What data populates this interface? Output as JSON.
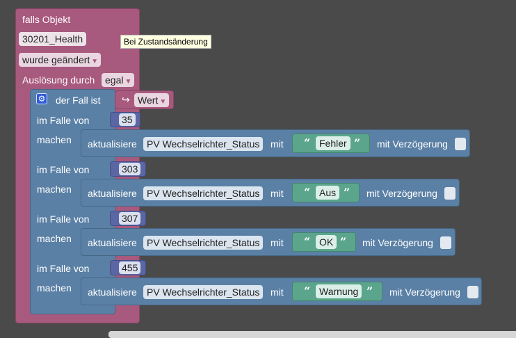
{
  "trigger": {
    "title": "falls Objekt",
    "object_id": "30201_Health",
    "condition": "wurde geändert",
    "trigger_label": "Auslösung durch",
    "trigger_value": "egal"
  },
  "tooltip": "Bei Zustandsänderung",
  "switch": {
    "label": "der Fall ist",
    "value_arrow": "↪",
    "value_label": "Wert",
    "case_label": "im Falle von",
    "do_label": "machen"
  },
  "cases": [
    {
      "value": "35",
      "action": "aktualisiere",
      "variable": "PV Wechselrichter_Status",
      "with": "mit",
      "text": "Fehler",
      "delay_label": "mit Verzögerung"
    },
    {
      "value": "303",
      "action": "aktualisiere",
      "variable": "PV Wechselrichter_Status",
      "with": "mit",
      "text": "Aus",
      "delay_label": "mit Verzögerung"
    },
    {
      "value": "307",
      "action": "aktualisiere",
      "variable": "PV Wechselrichter_Status",
      "with": "mit",
      "text": "OK",
      "delay_label": "mit Verzögerung"
    },
    {
      "value": "455",
      "action": "aktualisiere",
      "variable": "PV Wechselrichter_Status",
      "with": "mit",
      "text": "Warnung",
      "delay_label": "mit Verzögerung"
    }
  ],
  "quotes": {
    "open": "“",
    "close": "”"
  },
  "icons": {
    "gear": "gear-icon",
    "dropdown": "dropdown-arrow-icon"
  },
  "colors": {
    "trigger": "#a8597e",
    "switch": "#5b80a5",
    "number": "#5b67a5",
    "string": "#5ba58c",
    "workspace": "#4a4a4a"
  }
}
